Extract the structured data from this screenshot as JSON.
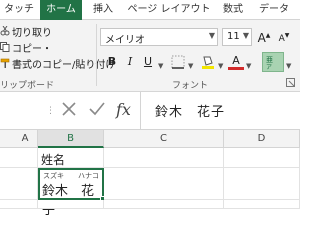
{
  "tabs": [
    {
      "label": "タッチ"
    },
    {
      "label": "ホーム"
    },
    {
      "label": "挿入"
    },
    {
      "label": "ページ レイアウト"
    },
    {
      "label": "数式"
    },
    {
      "label": "データ"
    }
  ],
  "clipboard": {
    "cut": "切り取り",
    "copy": "コピー・",
    "format_painter": "書式のコピー/貼り付け",
    "group_label": "リップボード"
  },
  "font": {
    "name": "メイリオ",
    "size": "11",
    "group_label": "フォント",
    "bold": "B",
    "italic": "I",
    "underline": "U",
    "font_color_glyph": "A",
    "grow_glyph": "A",
    "shrink_glyph": "A"
  },
  "formula_bar": {
    "content": "鈴木　花子",
    "fx": "fx"
  },
  "grid": {
    "columns": [
      "A",
      "B",
      "C",
      "D"
    ],
    "b1": "姓名",
    "b2_furigana": "スズキ　　ハナコ",
    "b2_value": "鈴木　花子"
  },
  "colors": {
    "accent": "#217346",
    "fill_highlight": "#f2e600",
    "font_color": "#d22b2b"
  }
}
